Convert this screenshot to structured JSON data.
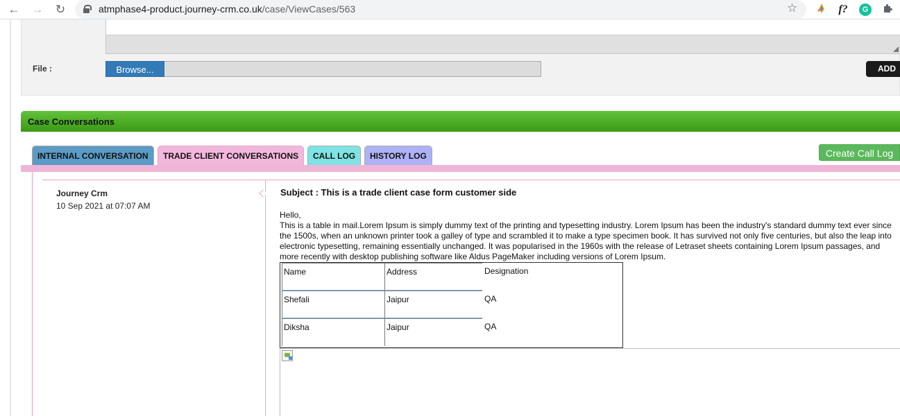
{
  "browser": {
    "url_host": "atmphase4-product.journey-crm.co.uk",
    "url_path": "/case/ViewCases/563",
    "icons": [
      "back-icon",
      "forward-icon",
      "reload-icon",
      "lock-icon",
      "bookmark-star-icon",
      "extension-icon",
      "formula-extension-icon",
      "grammarly-icon",
      "extensions-puzzle-icon"
    ],
    "ext_f_label": "f?",
    "ext_g_label": "G"
  },
  "file_section": {
    "label": "File :",
    "browse_label": "Browse...",
    "add_label": "ADD"
  },
  "conversations": {
    "header": "Case Conversations",
    "tabs": [
      {
        "label": "INTERNAL CONVERSATION",
        "color": "#5b9bc5"
      },
      {
        "label": "TRADE CLIENT CONVERSATIONS",
        "color": "#f2b8dc",
        "active": true
      },
      {
        "label": "CALL LOG",
        "color": "#7fe3e3"
      },
      {
        "label": "HISTORY LOG",
        "color": "#aeb1f5"
      }
    ],
    "create_call_log_label": "Create Call Log",
    "message": {
      "author": "Journey Crm",
      "date": "10 Sep 2021 at 07:07 AM",
      "subject": "Subject : This is a trade client case form customer side",
      "greeting": "Hello,",
      "body": "This is a table in mail.Lorem Ipsum is simply dummy text of the printing and typesetting industry. Lorem Ipsum has been the industry's standard dummy text ever since the 1500s, when an unknown printer took a galley of type and scrambled it to make a type specimen book. It has survived not only five centuries, but also the leap into electronic typesetting, remaining essentially unchanged. It was popularised in the 1960s with the release of Letraset sheets containing Lorem Ipsum passages, and more recently with desktop publishing software like Aldus PageMaker including versions of Lorem Ipsum.",
      "table": {
        "headers": [
          "Name",
          "Address",
          "Designation"
        ],
        "rows": [
          [
            "Shefali",
            "Jaipur",
            "QA"
          ],
          [
            "Diksha",
            "Jaipur",
            "QA"
          ]
        ]
      }
    }
  },
  "colors": {
    "header_green": "#4caf1f",
    "accent_pink": "#efb5d8",
    "browse_blue": "#337ab7",
    "create_green": "#5cb85c"
  }
}
